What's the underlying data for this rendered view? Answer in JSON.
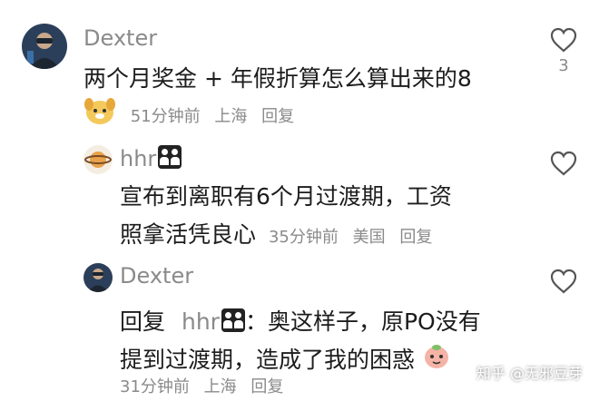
{
  "comments": [
    {
      "username": "Dexter",
      "text_line1": "两个月奖金 + 年假折算怎么算出来的8",
      "time": "51分钟前",
      "location": "上海",
      "reply_label": "回复",
      "likes": "3"
    },
    {
      "username": "hhr",
      "text_line1": "宣布到离职有6个月过渡期，工资",
      "text_line2": "照拿活凭良心",
      "time": "35分钟前",
      "location": "美国",
      "reply_label": "回复"
    },
    {
      "username": "Dexter",
      "reply_prefix": "回复",
      "reply_to": "hhr",
      "text_line1": "：奥这样子，原PO没有",
      "text_line2": "提到过渡期，造成了我的困惑",
      "time": "31分钟前",
      "location": "上海",
      "reply_label": "回复"
    }
  ],
  "watermark": "知乎 @无邪豆芽",
  "colors": {
    "text": "#1c1c1c",
    "meta": "#8a8a8a",
    "background": "#ffffff"
  },
  "icons": {
    "like": "heart-outline-icon",
    "badge": "couple-badge-icon"
  }
}
